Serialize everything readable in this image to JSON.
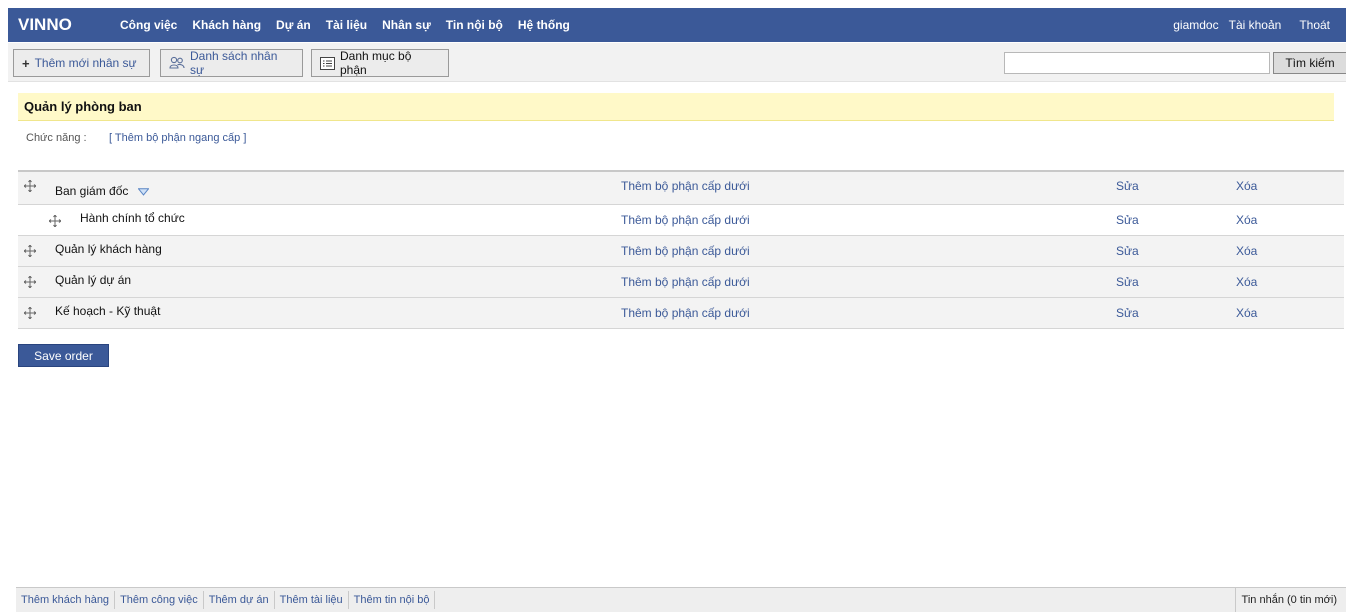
{
  "app": {
    "brand": "VINNO",
    "nav": [
      "Công việc",
      "Khách hàng",
      "Dự án",
      "Tài liệu",
      "Nhân sự",
      "Tin nội bộ",
      "Hệ thống"
    ],
    "user": "giamdoc",
    "account": "Tài khoản",
    "logout": "Thoát"
  },
  "toolbar": {
    "add_staff": "Thêm mới nhân sự",
    "staff_list": "Danh sách nhân sự",
    "dept_catalog": "Danh mục bộ phận",
    "search_value": "",
    "search_button": "Tìm kiếm"
  },
  "section": {
    "title": "Quản lý phòng ban",
    "func_label": "Chức năng :",
    "func_link": "[ Thêm bộ phận ngang cấp ]"
  },
  "departments": {
    "rows": [
      {
        "name": "Ban giám đốc",
        "level": 0,
        "add_child": "Thêm bộ phận cấp dưới",
        "edit": "Sửa",
        "delete": "Xóa"
      },
      {
        "name": "Hành chính tổ chức",
        "level": 1,
        "add_child": "Thêm bộ phận cấp dưới",
        "edit": "Sửa",
        "delete": "Xóa"
      },
      {
        "name": "Quản lý khách hàng",
        "level": 0,
        "add_child": "Thêm bộ phận cấp dưới",
        "edit": "Sửa",
        "delete": "Xóa"
      },
      {
        "name": "Quản lý dự án",
        "level": 0,
        "add_child": "Thêm bộ phận cấp dưới",
        "edit": "Sửa",
        "delete": "Xóa"
      },
      {
        "name": "Kế hoạch - Kỹ thuật",
        "level": 0,
        "add_child": "Thêm bộ phận cấp dưới",
        "edit": "Sửa",
        "delete": "Xóa"
      }
    ],
    "save_button": "Save order"
  },
  "footer": {
    "links": [
      "Thêm khách hàng",
      "Thêm công việc",
      "Thêm dự án",
      "Thêm tài liệu",
      "Thêm tin nội bộ"
    ],
    "messages": "Tin nhắn (0 tin mới)"
  },
  "colors": {
    "brand_blue": "#3b5998",
    "title_bg": "#fff9c8",
    "row_bg": "#f3f3f3"
  }
}
